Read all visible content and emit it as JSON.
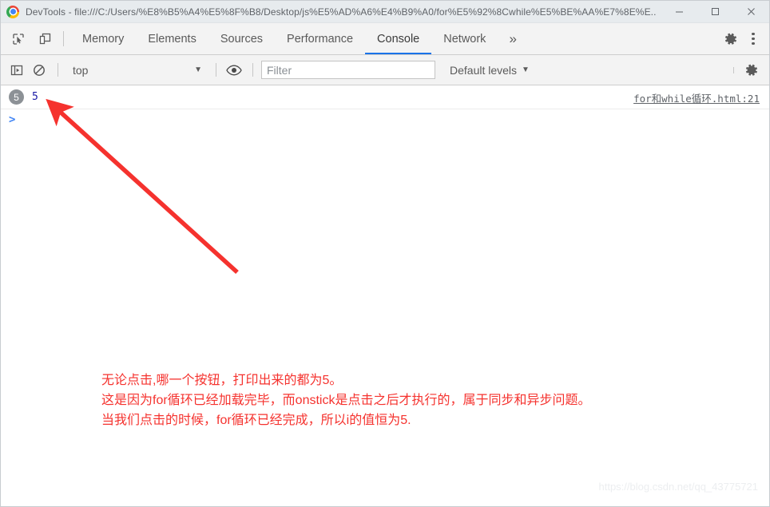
{
  "window": {
    "title": "DevTools - file:///C:/Users/%E8%B5%A4%E5%8F%B8/Desktop/js%E5%AD%A6%E4%B9%A0/for%E5%92%8Cwhile%E5%BE%AA%E7%8E%E...",
    "minimize_label": "minimize",
    "maximize_label": "maximize",
    "close_label": "close"
  },
  "tabbar": {
    "inspect_icon": "inspect-element-icon",
    "device_icon": "device-toolbar-icon",
    "tabs": [
      {
        "label": "Memory",
        "active": false
      },
      {
        "label": "Elements",
        "active": false
      },
      {
        "label": "Sources",
        "active": false
      },
      {
        "label": "Performance",
        "active": false
      },
      {
        "label": "Console",
        "active": true
      },
      {
        "label": "Network",
        "active": false
      }
    ],
    "more_label": "»",
    "settings_icon": "gear-icon",
    "menu_icon": "kebab-menu-icon"
  },
  "console_toolbar": {
    "execute_icon": "sidebar-toggle-icon",
    "clear_icon": "clear-console-icon",
    "context": "top",
    "context_caret": "▼",
    "eye_icon": "live-expressions-eye-icon",
    "filter_placeholder": "Filter",
    "filter_value": "",
    "levels_label": "Default levels",
    "levels_caret": "▼",
    "settings_icon": "console-settings-gear-icon"
  },
  "console": {
    "messages": [
      {
        "repeat_count": "5",
        "value": "5",
        "source": "for和while循环.html:21"
      }
    ],
    "prompt_caret": ">",
    "prompt_value": ""
  },
  "annotation": {
    "lines": [
      "无论点击,哪一个按钮，打印出来的都为5。",
      "这是因为for循环已经加载完毕，而onstick是点击之后才执行的，属于同步和异步问题。",
      "当我们点击的时候，for循环已经完成，所以i的值恒为5."
    ],
    "arrow_color": "#f5322e"
  },
  "watermark": "https://blog.csdn.net/qq_43775721",
  "colors": {
    "accent": "#1a73e8",
    "annotation_red": "#f5322e",
    "log_value_blue": "#1a1aa6",
    "badge_grey": "#8c9196"
  }
}
